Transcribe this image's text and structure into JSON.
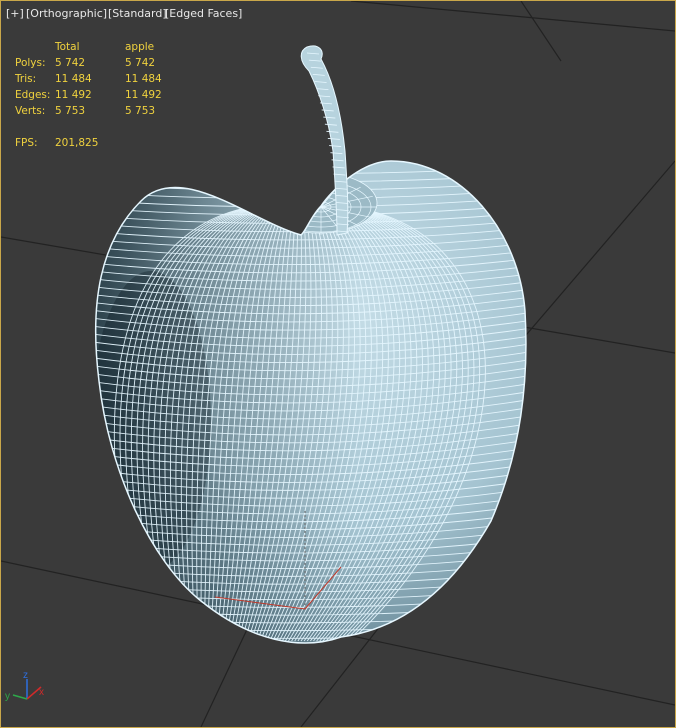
{
  "viewport": {
    "labels": [
      "[+]",
      "[Orthographic]",
      "[Standard]",
      "[Edged Faces]"
    ],
    "border_color": "#c9a74a",
    "background_color": "#3a3a3a",
    "mesh_color": "#dff6ff",
    "surface_color": "#a9cad6"
  },
  "stats": {
    "header": [
      "",
      "Total",
      "apple"
    ],
    "rows": [
      {
        "label": "Polys:",
        "total": "5 742",
        "object": "5 742"
      },
      {
        "label": "Tris:",
        "total": "11 484",
        "object": "11 484"
      },
      {
        "label": "Edges:",
        "total": "11 492",
        "object": "11 492"
      },
      {
        "label": "Verts:",
        "total": "5 753",
        "object": "5 753"
      }
    ],
    "fps_label": "FPS:",
    "fps_value": "201,825",
    "text_color": "#f0d23e"
  },
  "gizmo": {
    "z_label": "z",
    "y_label": "y",
    "x_label": "x"
  }
}
